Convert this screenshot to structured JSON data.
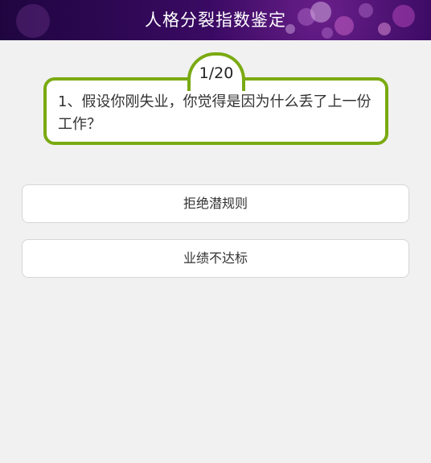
{
  "header": {
    "title": "人格分裂指数鉴定"
  },
  "question": {
    "counter": "1/20",
    "text": "1、假设你刚失业，你觉得是因为什么丢了上一份工作？"
  },
  "options": [
    {
      "label": "拒绝潜规则"
    },
    {
      "label": "业绩不达标"
    }
  ],
  "colors": {
    "header_bg": "#3a0a63",
    "accent_green": "#7aaa12",
    "page_bg": "#f1f1f1"
  }
}
